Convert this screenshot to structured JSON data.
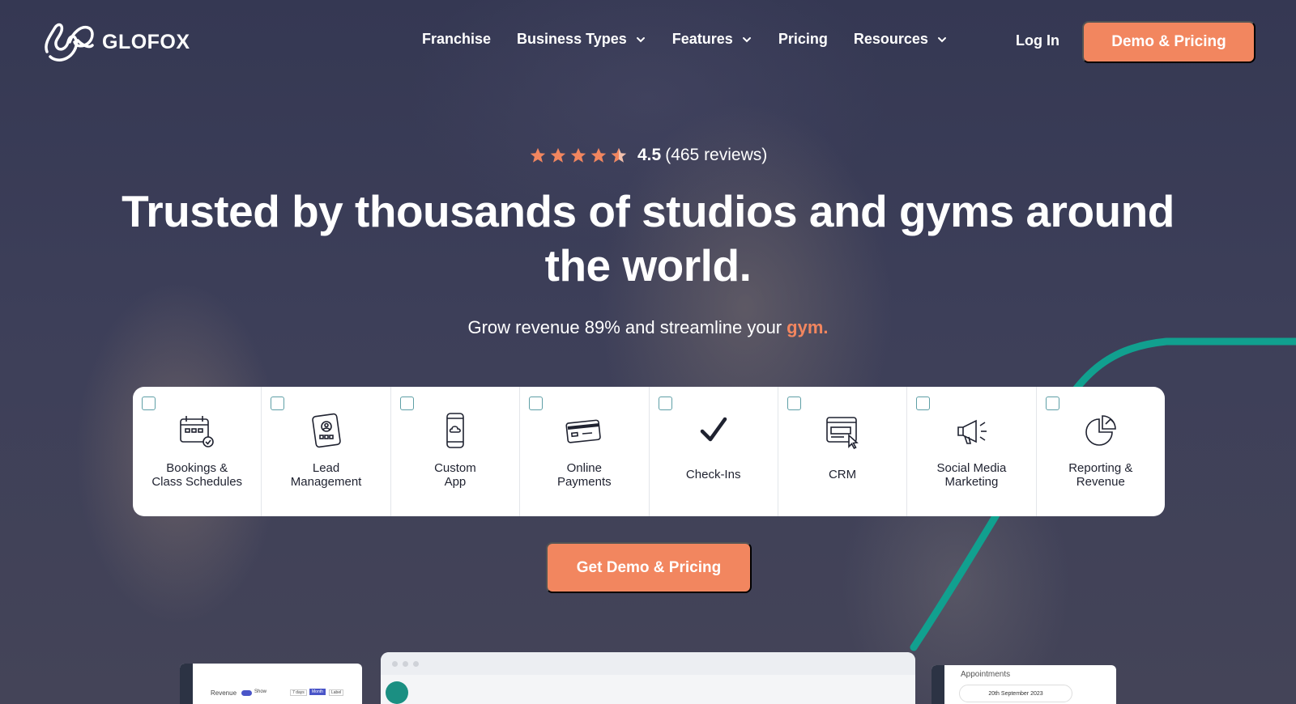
{
  "brand": {
    "name": "GLOFOX",
    "logo_icon": "glofox-logo-icon"
  },
  "nav": {
    "links": [
      {
        "label": "Franchise",
        "dropdown": false
      },
      {
        "label": "Business Types",
        "dropdown": true
      },
      {
        "label": "Features",
        "dropdown": true
      },
      {
        "label": "Pricing",
        "dropdown": false
      },
      {
        "label": "Resources",
        "dropdown": true
      }
    ],
    "login_label": "Log In",
    "demo_button_label": "Demo & Pricing"
  },
  "rating": {
    "stars": 4.5,
    "score": "4.5",
    "reviews": "(465 reviews)"
  },
  "hero": {
    "headline": "Trusted by thousands of studios and gyms around the world.",
    "subtitle": "Grow revenue 89% and streamline your",
    "subtitle_highlight": "gym.",
    "cta_label": "Get Demo & Pricing"
  },
  "features": [
    {
      "label": "Bookings &\nClass Schedules",
      "icon": "calendar-icon",
      "checked": false
    },
    {
      "label": "Lead\nManagement",
      "icon": "lead-badge-icon",
      "checked": false
    },
    {
      "label": "Custom\nApp",
      "icon": "mobile-app-icon",
      "checked": false
    },
    {
      "label": "Online\nPayments",
      "icon": "credit-card-icon",
      "checked": false
    },
    {
      "label": "Check-Ins",
      "icon": "checkmark-icon",
      "checked": false
    },
    {
      "label": "CRM",
      "icon": "crm-window-icon",
      "checked": false
    },
    {
      "label": "Social Media\nMarketing",
      "icon": "megaphone-icon",
      "checked": false
    },
    {
      "label": "Reporting &\nRevenue",
      "icon": "pie-chart-icon",
      "checked": false
    }
  ],
  "previews": {
    "left_title": "Revenue",
    "left_toggle": "Show",
    "left_ranges": [
      "7 days",
      "Month",
      "Label"
    ],
    "right_title": "Appointments",
    "right_date": "20th September 2023"
  },
  "colors": {
    "accent": "#f2865f",
    "teal": "#11a08f",
    "background": "#3a3d58"
  }
}
